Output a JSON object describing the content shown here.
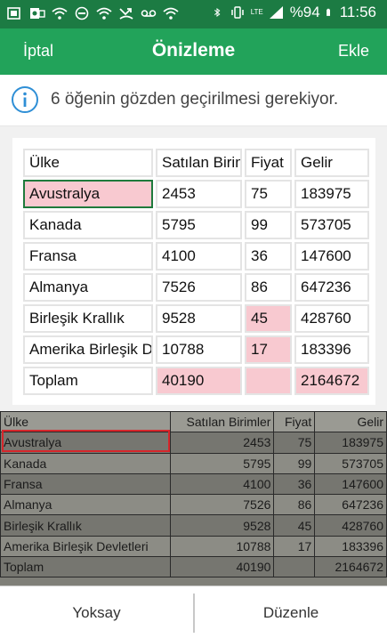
{
  "status_bar": {
    "battery": "%94",
    "time": "11:56",
    "network_type": "LTE",
    "icons": [
      "office-icon",
      "outlook-icon",
      "wifi-icon",
      "do-not-disturb-icon",
      "wifi-icon",
      "missed-call-icon",
      "voicemail-icon",
      "wifi-icon",
      "bluetooth-icon",
      "vibrate-icon",
      "signal-icon",
      "battery-icon"
    ],
    "color": "#1c7b43"
  },
  "action_bar": {
    "cancel_label": "İptal",
    "title": "Önizleme",
    "add_label": "Ekle",
    "color": "#22a35a"
  },
  "info": {
    "message": "6 öğenin gözden geçirilmesi gerekiyor.",
    "icon": "info-icon",
    "icon_color": "#2f8fd6"
  },
  "preview": {
    "rows": [
      [
        "Ülke",
        "Satılan Birimler",
        "Fiyat",
        "Gelir"
      ],
      [
        "Avustralya",
        "2453",
        "75",
        "183975"
      ],
      [
        "Kanada",
        "5795",
        "99",
        "573705"
      ],
      [
        "Fransa",
        "4100",
        "36",
        "147600"
      ],
      [
        "Almanya",
        "7526",
        "86",
        "647236"
      ],
      [
        "Birleşik Krallık",
        "9528",
        "45",
        "428760"
      ],
      [
        "Amerika Birleşik Devletleri",
        "10788",
        "17",
        "183396"
      ],
      [
        "Toplam",
        "40190",
        "",
        "2164672"
      ]
    ],
    "flag_color": "#f8c9d0",
    "selection_color": "#1f7a3c"
  },
  "photo": {
    "rows": [
      [
        "Ülke",
        "Satılan Birimler",
        "Fiyat",
        "Gelir"
      ],
      [
        "Avustralya",
        "2453",
        "75",
        "183975"
      ],
      [
        "Kanada",
        "5795",
        "99",
        "573705"
      ],
      [
        "Fransa",
        "4100",
        "36",
        "147600"
      ],
      [
        "Almanya",
        "7526",
        "86",
        "647236"
      ],
      [
        "Birleşik Krallık",
        "9528",
        "45",
        "428760"
      ],
      [
        "Amerika Birleşik Devletleri",
        "10788",
        "17",
        "183396"
      ],
      [
        "Toplam",
        "40190",
        "",
        "2164672"
      ]
    ],
    "highlight_color": "#d7262b"
  },
  "bottom_bar": {
    "ignore_label": "Yoksay",
    "edit_label": "Düzenle"
  }
}
